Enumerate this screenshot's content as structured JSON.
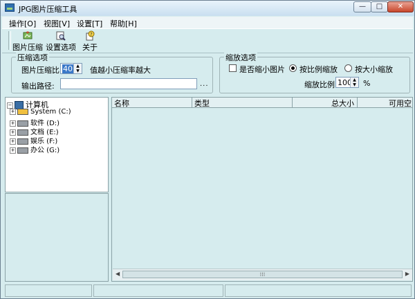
{
  "window": {
    "title": "JPG图片压缩工具",
    "controls": {
      "minimize": "—",
      "maximize": "□",
      "close": "✕"
    }
  },
  "menu": [
    {
      "label": "操作[O]"
    },
    {
      "label": "视图[V]"
    },
    {
      "label": "设置[T]"
    },
    {
      "label": "帮助[H]"
    }
  ],
  "toolbar": {
    "compress": {
      "label": "图片压缩",
      "icon": "image-compress-icon"
    },
    "settings": {
      "label": "设置选项",
      "icon": "settings-magnifier-icon"
    },
    "about": {
      "label": "关于",
      "icon": "about-help-icon"
    }
  },
  "compress_options": {
    "legend": "压缩选项",
    "ratio_label": "图片压缩比",
    "ratio_value": "40",
    "ratio_hint": "值越小压缩率越大",
    "output_label": "输出路径:",
    "output_value": "",
    "browse": "..."
  },
  "scale_options": {
    "legend": "缩放选项",
    "shrink_label": "是否缩小图片",
    "shrink_checked": false,
    "by_ratio_label": "按比例缩放",
    "by_ratio_selected": true,
    "by_size_label": "按大小缩放",
    "by_size_selected": false,
    "ratio_label": "缩放比例",
    "ratio_value": "100",
    "ratio_unit": "%"
  },
  "tree": {
    "root": "计算机",
    "drives": [
      {
        "label": "System (C:)"
      },
      {
        "label": "软件 (D:)"
      },
      {
        "label": "文档 (E:)"
      },
      {
        "label": "娱乐 (F:)"
      },
      {
        "label": "办公 (G:)"
      }
    ]
  },
  "file_list": {
    "columns": [
      "名称",
      "类型",
      "总大小",
      "可用空"
    ],
    "rows": []
  },
  "colors": {
    "background": "#d6ecee",
    "accent": "#2f6fb0"
  }
}
